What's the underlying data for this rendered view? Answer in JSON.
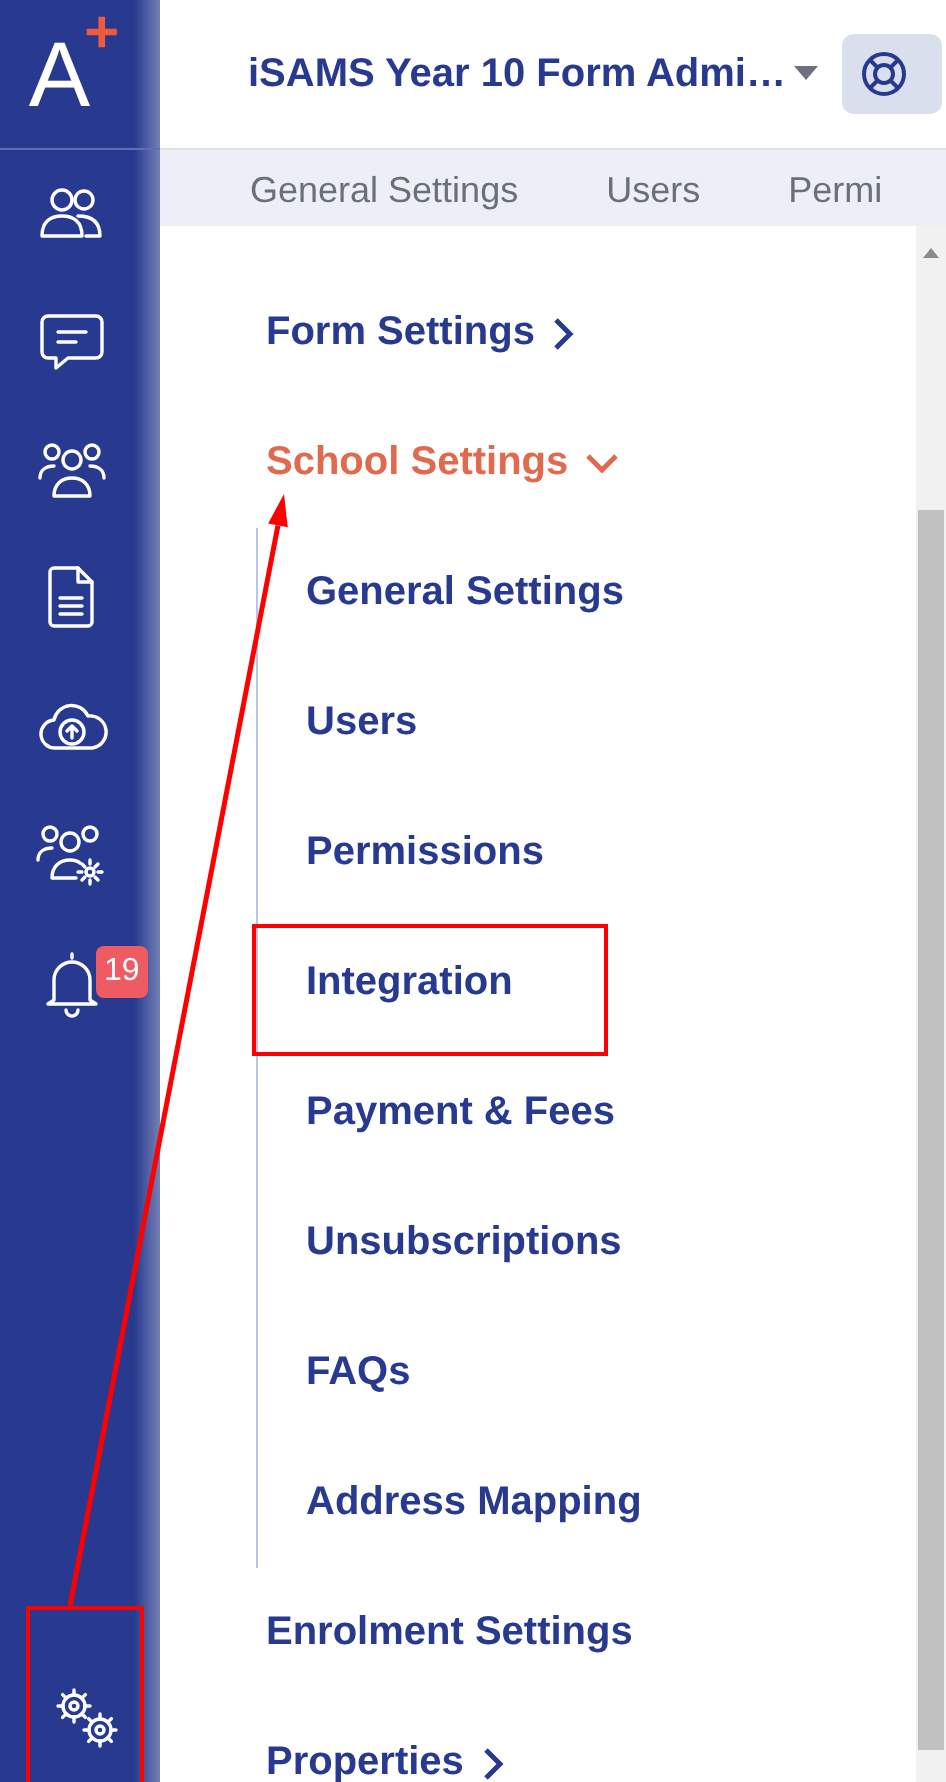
{
  "logo": {
    "letter": "A",
    "mark": "+"
  },
  "sidebar": {
    "items": [
      {
        "kind": "people",
        "highlighted": false
      },
      {
        "kind": "chat",
        "highlighted": false
      },
      {
        "kind": "group",
        "highlighted": false
      },
      {
        "kind": "document",
        "highlighted": false
      },
      {
        "kind": "upload",
        "highlighted": false
      },
      {
        "kind": "roles",
        "highlighted": false
      },
      {
        "kind": "bell",
        "highlighted": false,
        "badge": "19"
      }
    ],
    "bottom_item": {
      "kind": "gears",
      "highlighted": true
    }
  },
  "header": {
    "title": "iSAMS Year 10 Form Admi…"
  },
  "tabs": [
    {
      "label": "General Settings"
    },
    {
      "label": "Users"
    },
    {
      "label": "Permi"
    }
  ],
  "menu": [
    {
      "kind": "group",
      "label": "Form Settings",
      "expanded": false,
      "arrow_target": false
    },
    {
      "kind": "group",
      "label": "School Settings",
      "expanded": true,
      "arrow_target": true,
      "children": [
        {
          "label": "General Settings",
          "highlighted": false
        },
        {
          "label": "Users",
          "highlighted": false
        },
        {
          "label": "Permissions",
          "highlighted": false
        },
        {
          "label": "Integration",
          "highlighted": true
        },
        {
          "label": "Payment & Fees",
          "highlighted": false
        },
        {
          "label": "Unsubscriptions",
          "highlighted": false
        },
        {
          "label": "FAQs",
          "highlighted": false
        },
        {
          "label": "Address Mapping",
          "highlighted": false
        }
      ]
    },
    {
      "kind": "link",
      "label": "Enrolment Settings",
      "arrow_target": false
    },
    {
      "kind": "group",
      "label": "Properties",
      "expanded": false,
      "arrow_target": false
    }
  ]
}
